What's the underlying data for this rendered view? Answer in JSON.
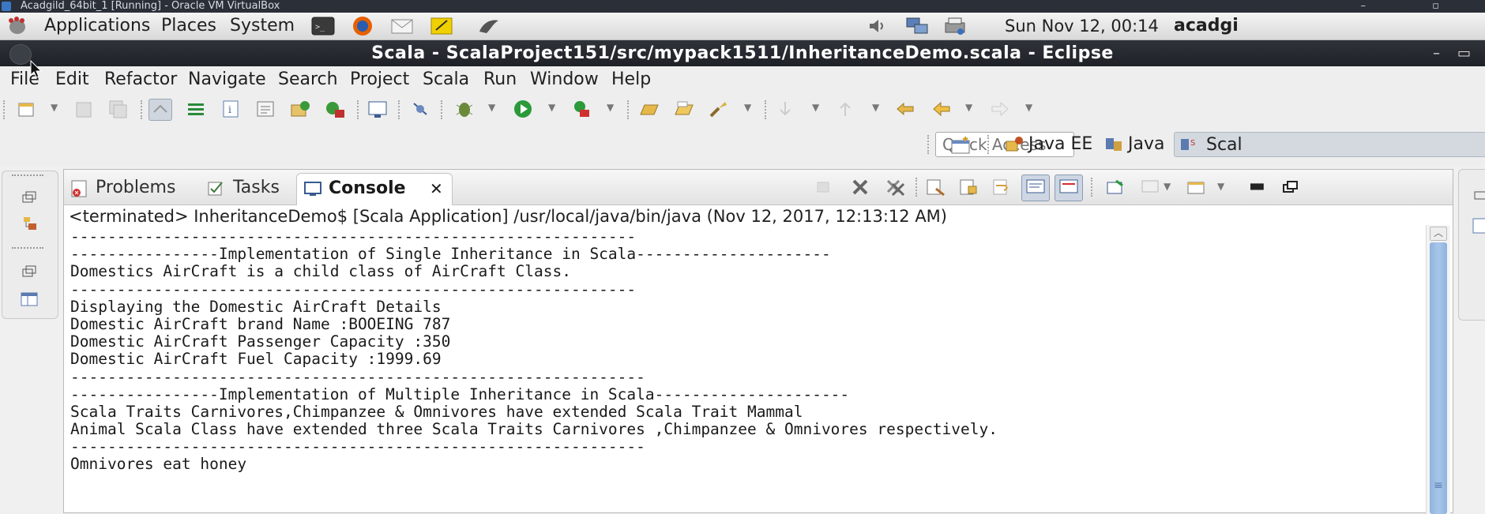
{
  "vbox": {
    "title": "Acadgild_64bit_1 [Running] - Oracle VM VirtualBox"
  },
  "gnome_panel": {
    "menus": [
      "Applications",
      "Places",
      "System"
    ],
    "clock": "Sun Nov 12, 00:14",
    "user": "acadgi"
  },
  "window": {
    "title": "Scala - ScalaProject151/src/mypack1511/InheritanceDemo.scala - Eclipse"
  },
  "menubar": {
    "items": [
      "File",
      "Edit",
      "Refactor",
      "Navigate",
      "Search",
      "Project",
      "Scala",
      "Run",
      "Window",
      "Help"
    ]
  },
  "perspectives": {
    "quick_access_placeholder": "Quick Access",
    "items": [
      "Java EE",
      "Java",
      "Scal"
    ]
  },
  "views": {
    "tabs": [
      "Problems",
      "Tasks",
      "Console"
    ],
    "active_tab": "Console"
  },
  "console": {
    "status": "<terminated> InheritanceDemo$ [Scala Application] /usr/local/java/bin/java (Nov 12, 2017, 12:13:12 AM)",
    "lines": [
      "-------------------------------------------------------------",
      "----------------Implementation of Single Inheritance in Scala---------------------",
      "Domestics AirCraft is a child class of AirCraft Class.",
      "-------------------------------------------------------------",
      "Displaying the Domestic AirCraft Details",
      "Domestic AirCraft brand Name :BOOEING 787",
      "Domestic AirCraft Passenger Capacity :350",
      "Domestic AirCraft Fuel Capacity :1999.69",
      "--------------------------------------------------------------",
      "----------------Implementation of Multiple Inheritance in Scala---------------------",
      "Scala Traits Carnivores,Chimpanzee & Omnivores have extended Scala Trait Mammal",
      "Animal Scala Class have extended three Scala Traits Carnivores ,Chimpanzee & Omnivores respectively.",
      "--------------------------------------------------------------",
      "Omnivores eat honey"
    ]
  },
  "colors": {
    "title_bar": "#24282e",
    "panel": "#e6e6e6",
    "scroll_thumb": "#9dbce4"
  }
}
